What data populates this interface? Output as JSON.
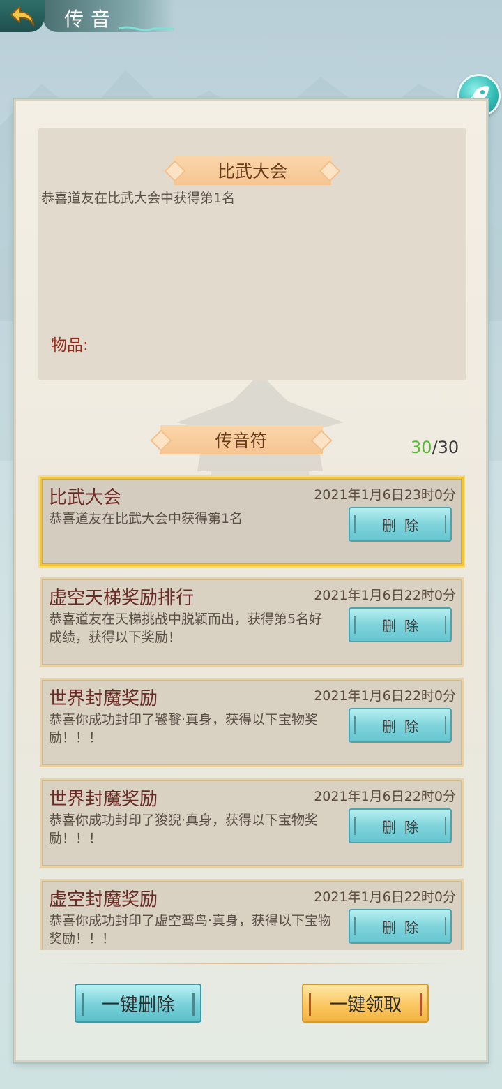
{
  "header": {
    "title": "传音"
  },
  "detail": {
    "title": "比武大会",
    "body": "恭喜道友在比武大会中获得第1名",
    "items_label": "物品:"
  },
  "list": {
    "ribbon": "传音符",
    "count_current": "30",
    "count_total": "/30",
    "delete_label": "删除",
    "messages": [
      {
        "title": "比武大会",
        "time": "2021年1月6日23时0分",
        "body": "恭喜道友在比武大会中获得第1名",
        "selected": true
      },
      {
        "title": "虚空天梯奖励排行",
        "time": "2021年1月6日22时0分",
        "body": "恭喜道友在天梯挑战中脱颖而出，获得第5名好成绩，获得以下奖励！"
      },
      {
        "title": "世界封魔奖励",
        "time": "2021年1月6日22时0分",
        "body": "恭喜你成功封印了饕餮·真身，获得以下宝物奖励！！！"
      },
      {
        "title": "世界封魔奖励",
        "time": "2021年1月6日22时0分",
        "body": "恭喜你成功封印了狻猊·真身，获得以下宝物奖励！！！"
      },
      {
        "title": "虚空封魔奖励",
        "time": "2021年1月6日22时0分",
        "body": "恭喜你成功封印了虚空鸾鸟·真身，获得以下宝物奖励！！！"
      }
    ]
  },
  "actions": {
    "delete_all": "一键删除",
    "claim_all": "一键领取"
  },
  "icons": {
    "back": "back-arrow-icon",
    "rocket": "rocket-icon"
  },
  "colors": {
    "accent_teal": "#7fd4db",
    "accent_gold": "#fbc861",
    "count_green": "#5ab53a",
    "title_red": "#6c2a24"
  }
}
